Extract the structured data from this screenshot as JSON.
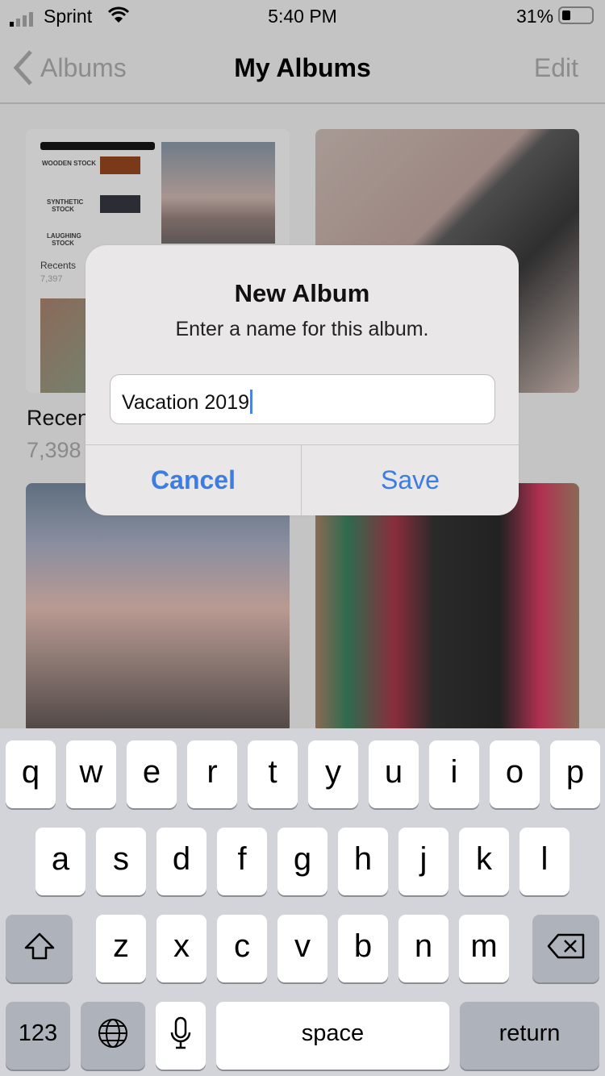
{
  "status": {
    "carrier": "Sprint",
    "time": "5:40 PM",
    "battery": "31%",
    "battery_level": 0.31
  },
  "nav": {
    "back_label": "Albums",
    "title": "My Albums",
    "edit_label": "Edit"
  },
  "albums": [
    {
      "name": "Recents",
      "count": "7,398"
    }
  ],
  "thumb_preview": {
    "title": "My Albums",
    "rows": [
      "WOODEN STOCK",
      "SYNTHETIC STOCK",
      "LAUGHING STOCK"
    ],
    "album": "Recents",
    "count": "7,397"
  },
  "dialog": {
    "title": "New Album",
    "message": "Enter a name for this album.",
    "input_value": "Vacation 2019",
    "cancel_label": "Cancel",
    "save_label": "Save"
  },
  "keyboard": {
    "row1": [
      "q",
      "w",
      "e",
      "r",
      "t",
      "y",
      "u",
      "i",
      "o",
      "p"
    ],
    "row2": [
      "a",
      "s",
      "d",
      "f",
      "g",
      "h",
      "j",
      "k",
      "l"
    ],
    "row3": [
      "z",
      "x",
      "c",
      "v",
      "b",
      "n",
      "m"
    ],
    "numbers_label": "123",
    "space_label": "space",
    "return_label": "return"
  }
}
